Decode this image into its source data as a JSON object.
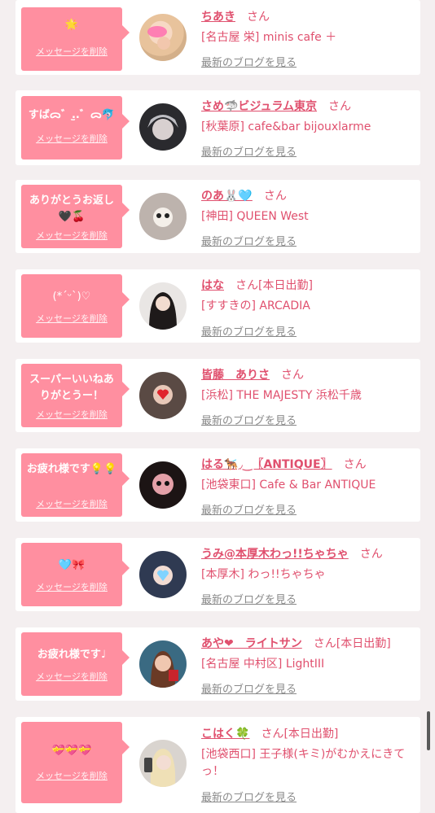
{
  "common": {
    "san": "さん",
    "delete_label": "メッセージを削除",
    "blog_label": "最新のブログを見る"
  },
  "cards": [
    {
      "message": "🌟",
      "name": "ちあき",
      "tag": "",
      "shop": "[名古屋 栄] minis cafe ＋"
    },
    {
      "message": "すば﻿ᯅ゛.̫.゛ᯅ🐬",
      "name": "さめ🦈ビジュラム東京",
      "tag": "",
      "shop": "[秋葉原] cafe&bar bijouxlarme"
    },
    {
      "message": "ありがとうお返し🖤🍒",
      "name": "のあ🐰🩵",
      "tag": "",
      "shop": "[神田] QUEEN West"
    },
    {
      "message": "(*ˊᵕˋ)♡",
      "name": "はな",
      "tag": "[本日出勤]",
      "shop": "[すすきの] ARCADIA"
    },
    {
      "message": "スーパーいいねありがとうー！",
      "name": "皆藤　ありさ",
      "tag": "",
      "shop": "[浜松] THE MAJESTY 浜松千歳"
    },
    {
      "message": "お疲れ様です💡💡",
      "name": "はる🐕‍🦺◞‿〖ANTIQUE〗",
      "tag": "",
      "shop": "[池袋東口] Cafe & Bar ANTIQUE"
    },
    {
      "message": "🩵🎀",
      "name": "うみ@本厚木わっ!!ちゃちゃ",
      "tag": "",
      "shop": "[本厚木] わっ!!ちゃちゃ"
    },
    {
      "message": "お疲れ様です♩",
      "name": "あや❤︎　ライトサン",
      "tag": "[本日出勤]",
      "shop": "[名古屋 中村区] LightIII"
    },
    {
      "message": "💝💝💝",
      "name": "こはく🍀",
      "tag": "[本日出勤]",
      "shop": "[池袋西口] 王子様(キミ)がむかえにきてっ！"
    }
  ],
  "colors": {
    "bubble": "#ff8fa0",
    "accent": "#e0506e",
    "link_gray": "#8a8a8a",
    "page_bg": "#f4eff0"
  }
}
